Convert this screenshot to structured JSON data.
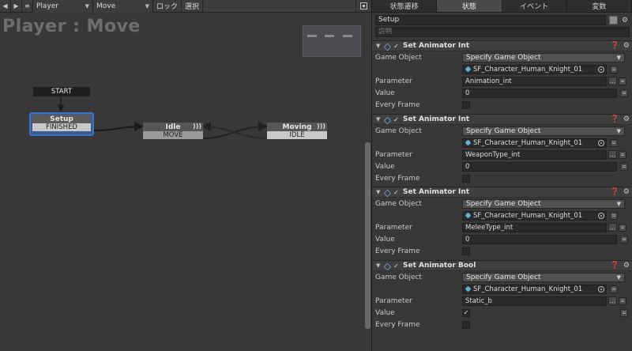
{
  "toolbar": {
    "prev_icon": "triangle-left-icon",
    "next_icon": "triangle-right-icon",
    "menu_icon": "hamburger-icon",
    "fsm_name": "Player",
    "fsm_state": "Move",
    "lock_label": "ロック",
    "select_label": "選択",
    "view_icon": "frame-icon"
  },
  "graph": {
    "title": "Player : Move",
    "start_label": "START",
    "states": [
      {
        "name": "Setup",
        "event": "FINISHED",
        "selected": true
      },
      {
        "name": "Idle",
        "event": "MOVE"
      },
      {
        "name": "Moving",
        "event": "IDLE"
      }
    ]
  },
  "inspector": {
    "tabs": [
      "状態遷移",
      "状態",
      "イベント",
      "変数"
    ],
    "active_tab": 1,
    "state_name": "Setup",
    "description_placeholder": "説明",
    "actions": [
      {
        "title": "Set Animator Int",
        "game_object_label": "Game Object",
        "game_object_mode": "Specify Game Object",
        "object_name": "SF_Character_Human_Knight_01",
        "parameter_label": "Parameter",
        "parameter_value": "Animation_int",
        "value_label": "Value",
        "value": "0",
        "every_frame_label": "Every Frame",
        "every_frame": false
      },
      {
        "title": "Set Animator Int",
        "game_object_label": "Game Object",
        "game_object_mode": "Specify Game Object",
        "object_name": "SF_Character_Human_Knight_01",
        "parameter_label": "Parameter",
        "parameter_value": "WeaponType_int",
        "value_label": "Value",
        "value": "0",
        "every_frame_label": "Every Frame",
        "every_frame": false
      },
      {
        "title": "Set Animator Int",
        "game_object_label": "Game Object",
        "game_object_mode": "Specify Game Object",
        "object_name": "SF_Character_Human_Knight_01",
        "parameter_label": "Parameter",
        "parameter_value": "MeleeType_int",
        "value_label": "Value",
        "value": "0",
        "every_frame_label": "Every Frame",
        "every_frame": false
      },
      {
        "title": "Set Animator Bool",
        "game_object_label": "Game Object",
        "game_object_mode": "Specify Game Object",
        "object_name": "SF_Character_Human_Knight_01",
        "parameter_label": "Parameter",
        "parameter_value": "Static_b",
        "value_label": "Value",
        "value": "✓",
        "every_frame_label": "Every Frame",
        "every_frame": false
      }
    ]
  },
  "colors": {
    "selected_outline": "#3a72c8",
    "panel_bg": "#383838"
  }
}
